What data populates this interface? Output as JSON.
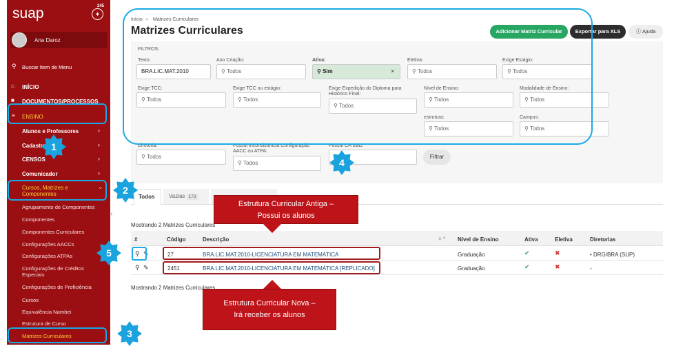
{
  "app": {
    "logo": "suap",
    "notifications": "245",
    "user": "Ana Daroz",
    "search_label": "Buscar Item de Menu"
  },
  "menu": {
    "inicio": "INÍCIO",
    "documentos": "DOCUMENTOS/PROCESSOS",
    "ensino": "ENSINO",
    "sub": [
      "Alunos e Professores",
      "Cadastros",
      "CENSOS",
      "Comunicador",
      "Cursos, Matrizes e Componentes"
    ],
    "items": [
      "Agrupamento de Componentes",
      "Componentes",
      "Componentes Curriculares",
      "Configurações AACCs",
      "Configurações ATPAs",
      "Configurações de Créditos Especiais",
      "Configurações de Proficiência",
      "Cursos",
      "Equivalência Nambei",
      "Estrutura de Curso",
      "Matrizes Curriculares"
    ]
  },
  "breadcrumb": {
    "home": "Início",
    "sep": "»",
    "current": "Matrizes Curriculares"
  },
  "page_title": "Matrizes Curriculares",
  "buttons": {
    "add": "Adicionar Matriz Curricular",
    "export": "Exportar para XLS",
    "help": "Ajuda",
    "filter": "Filtrar"
  },
  "filters": {
    "heading": "FILTROS:",
    "placeholder": "Todos",
    "texto": {
      "label": "Texto:",
      "value": "BRA.LIC.MAT.2010"
    },
    "ano": "Ano Criação:",
    "ativa": {
      "label": "Ativa:",
      "value": "Sim"
    },
    "eletiva": "Eletiva:",
    "estagio": "Exige Estágio:",
    "tcc": "Exige TCC:",
    "tcc_estagio": "Exige TCC ou estágio:",
    "expedicao": "Exige Expedição do Diploma para Histórico Final:",
    "nivel": "Nível de Ensino:",
    "modalidade": "Modalidade de Ensino:",
    "estrutura": "estrutura:",
    "campus": "Campus:",
    "diretoria": "Diretoria:",
    "inconsistencia": "Possui Inconsistência Configuração AACC ou ATPA:",
    "ead": "Possui CH EaD:"
  },
  "tabs": {
    "todos": "Todos",
    "vazias": "Vazias",
    "vazias_count": "173"
  },
  "showing": "Mostrando 2 Matrizes Curriculares",
  "table": {
    "headers": [
      "#",
      "Código",
      "Descrição",
      "Nível de Ensino",
      "Ativa",
      "Eletiva",
      "Diretorias"
    ],
    "rows": [
      {
        "codigo": "27",
        "descricao": "BRA.LIC.MAT.2010-LICENCIATURA EM MATEMÁTICA",
        "nivel": "Graduação",
        "diretorias": "DRG/BRA (SUP)"
      },
      {
        "codigo": "2451",
        "descricao": "BRA.LIC.MAT.2010-LICENCIATURA EM MATEMÁTICA [REPLICADO]",
        "nivel": "Graduação",
        "diretorias": "-"
      }
    ]
  },
  "callouts": {
    "old_line1": "Estrutura Curricular Antiga –",
    "old_line2": "Possui os alunos",
    "new_line1": "Estrutura Curricular Nova –",
    "new_line2": "Irá receber os alunos"
  },
  "badges": [
    "1",
    "2",
    "3",
    "4",
    "5"
  ],
  "colors": {
    "sidebar": "#9b0f12",
    "highlight": "#19a9e6",
    "callout": "#be1319",
    "green": "#27a664"
  }
}
